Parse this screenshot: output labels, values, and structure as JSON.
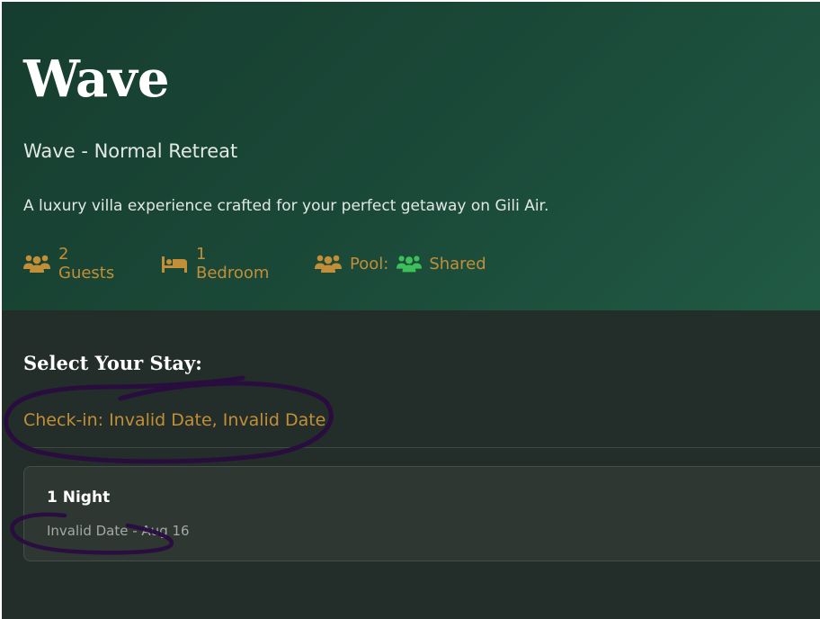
{
  "villa": {
    "name": "Wave",
    "subtitle": "Wave - Normal Retreat",
    "description": "A luxury villa experience crafted for your perfect getaway on Gili Air."
  },
  "meta": {
    "guests": {
      "icon": "users-icon",
      "label": "2 Guests"
    },
    "bedroom": {
      "icon": "bed-icon",
      "label": "1 Bedroom"
    },
    "pool": {
      "icon": "users-icon",
      "label": "Pool:",
      "shared_icon": "users-icon",
      "shared_label": "Shared"
    }
  },
  "booking": {
    "heading": "Select Your Stay:",
    "checkin": "Check-in: Invalid Date, Invalid Date",
    "options": [
      {
        "nights": "1 Night",
        "dates": "Invalid Date - Aug 16"
      }
    ]
  },
  "colors": {
    "hero": "#1b4a39",
    "accent": "#c28f38",
    "shared_icon": "#3fbf5a",
    "annotation_ink": "#2a0b40"
  }
}
